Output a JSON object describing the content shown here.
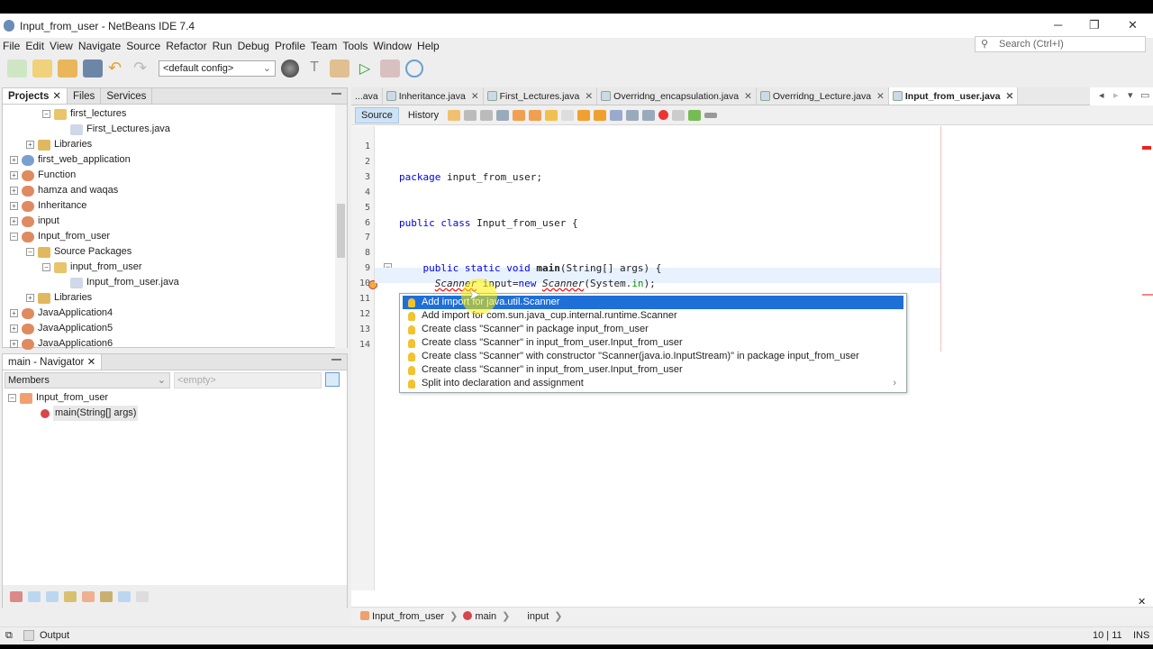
{
  "window": {
    "title": "Input_from_user - NetBeans IDE 7.4",
    "search_placeholder": "Search (Ctrl+I)"
  },
  "menu": [
    "File",
    "Edit",
    "View",
    "Navigate",
    "Source",
    "Refactor",
    "Run",
    "Debug",
    "Profile",
    "Team",
    "Tools",
    "Window",
    "Help"
  ],
  "toolbar": {
    "config": "<default config>"
  },
  "projects": {
    "tabs": [
      "Projects",
      "Files",
      "Services"
    ],
    "tree": [
      {
        "label": "first_lectures",
        "level": 3,
        "type": "package",
        "exp": "-"
      },
      {
        "label": "First_Lectures.java",
        "level": 4,
        "type": "java"
      },
      {
        "label": "Libraries",
        "level": 2,
        "type": "lib",
        "exp": "+"
      },
      {
        "label": "first_web_application",
        "level": 1,
        "type": "web",
        "exp": "+"
      },
      {
        "label": "Function",
        "level": 1,
        "type": "proj",
        "exp": "+"
      },
      {
        "label": "hamza and waqas",
        "level": 1,
        "type": "proj",
        "exp": "+"
      },
      {
        "label": "Inheritance",
        "level": 1,
        "type": "proj",
        "exp": "+"
      },
      {
        "label": "input",
        "level": 1,
        "type": "proj",
        "exp": "+"
      },
      {
        "label": "Input_from_user",
        "level": 1,
        "type": "proj",
        "exp": "-"
      },
      {
        "label": "Source Packages",
        "level": 2,
        "type": "lib",
        "exp": "-"
      },
      {
        "label": "input_from_user",
        "level": 3,
        "type": "package",
        "exp": "-"
      },
      {
        "label": "Input_from_user.java",
        "level": 4,
        "type": "java"
      },
      {
        "label": "Libraries",
        "level": 2,
        "type": "lib",
        "exp": "+"
      },
      {
        "label": "JavaApplication4",
        "level": 1,
        "type": "proj",
        "exp": "+"
      },
      {
        "label": "JavaApplication5",
        "level": 1,
        "type": "proj",
        "exp": "+"
      },
      {
        "label": "JavaApplication6",
        "level": 1,
        "type": "proj",
        "exp": "+"
      }
    ]
  },
  "navigator": {
    "title": "main - Navigator",
    "filter": "Members",
    "empty": "<empty>",
    "class": "Input_from_user",
    "method": "main(String[] args)"
  },
  "editor": {
    "tabs": [
      "...ava",
      "Inheritance.java",
      "First_Lectures.java",
      "Overridng_encapsulation.java",
      "Overridng_Lecture.java",
      "Input_from_user.java"
    ],
    "source_tab": "Source",
    "history_tab": "History",
    "lines": [
      [],
      [],
      [
        [
          "package ",
          "kw"
        ],
        [
          "input_from_user;",
          ""
        ]
      ],
      [],
      [],
      [
        [
          "public class ",
          "kw"
        ],
        [
          "Input_from_user {",
          ""
        ]
      ],
      [],
      [],
      [
        [
          "    public static void ",
          "kw"
        ],
        [
          "main",
          "b"
        ],
        [
          "(String[] args) {",
          ""
        ]
      ],
      [
        [
          "      ",
          ""
        ],
        [
          "Scanner",
          "it err"
        ],
        [
          " input=",
          ""
        ],
        [
          "new ",
          "kw"
        ],
        [
          "Scanner",
          "it err"
        ],
        [
          "(System.",
          ""
        ],
        [
          "in",
          "pkg"
        ],
        [
          ");",
          ""
        ]
      ],
      [],
      [],
      [],
      []
    ]
  },
  "hints": [
    "Add import for java.util.Scanner",
    "Add import for com.sun.java_cup.internal.runtime.Scanner",
    "Create class \"Scanner\" in package input_from_user",
    "Create class \"Scanner\" in input_from_user.Input_from_user",
    "Create class \"Scanner\" with constructor \"Scanner(java.io.InputStream)\" in package input_from_user",
    "Create class \"Scanner\" in input_from_user.Input_from_user",
    "Split into declaration and assignment"
  ],
  "breadcrumbs": [
    "Input_from_user",
    "main",
    "input"
  ],
  "status": {
    "output": "Output",
    "position": "10 | 11",
    "mode": "INS"
  }
}
